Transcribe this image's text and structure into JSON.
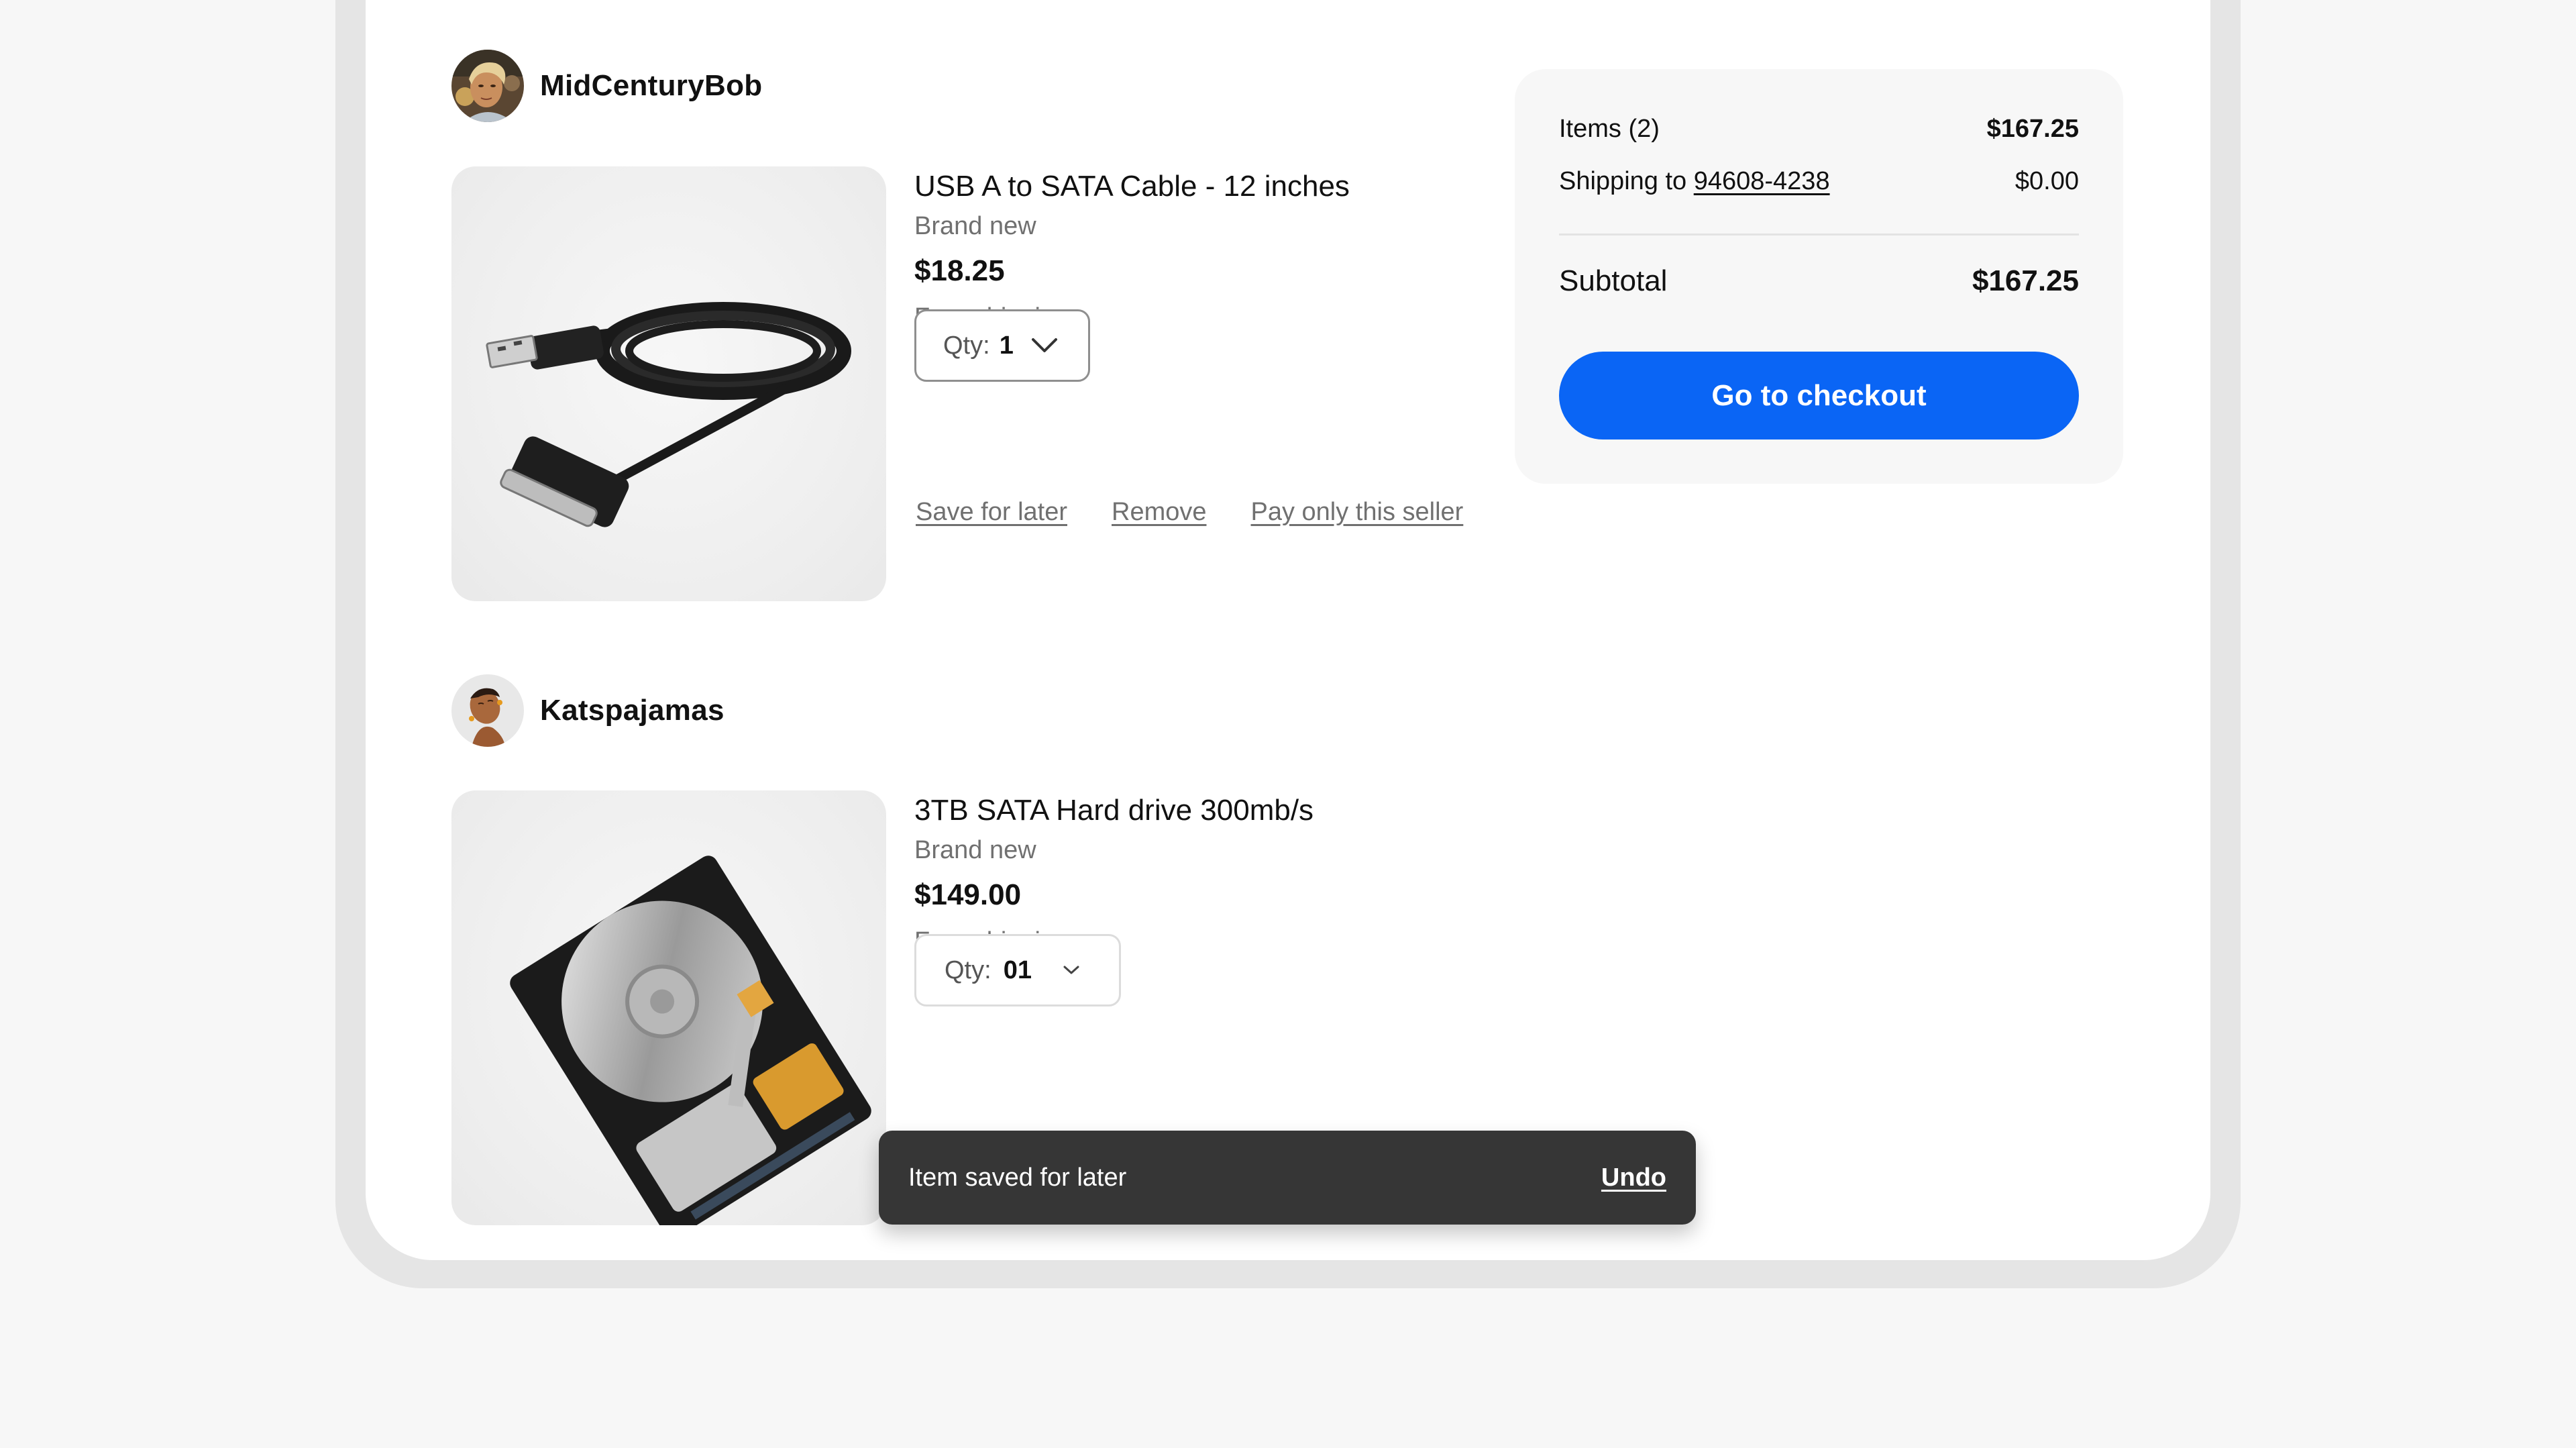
{
  "sellers": [
    {
      "name": "MidCenturyBob",
      "avatar_icon": "user-avatar-photo",
      "item": {
        "title": "USB A to SATA Cable - 12 inches",
        "condition": "Brand new",
        "price": "$18.25",
        "shipping": "Free shipping",
        "qty_label": "Qty:",
        "qty_value": "1",
        "image_icon": "usb-cable-photo"
      },
      "actions": [
        "Save for later",
        "Remove",
        "Pay only this seller"
      ]
    },
    {
      "name": "Katspajamas",
      "avatar_icon": "user-avatar-photo",
      "item": {
        "title": "3TB SATA Hard drive 300mb/s",
        "condition": "Brand new",
        "price": "$149.00",
        "shipping": "Free shipping",
        "qty_label": "Qty:",
        "qty_value": "01",
        "image_icon": "hard-drive-photo"
      }
    }
  ],
  "summary": {
    "items_label": "Items (2)",
    "items_value": "$167.25",
    "shipping_prefix": "Shipping to",
    "shipping_zip": "94608-4238",
    "shipping_value": "$0.00",
    "subtotal_label": "Subtotal",
    "subtotal_value": "$167.25",
    "checkout_label": "Go to checkout"
  },
  "toast": {
    "message": "Item saved for later",
    "action": "Undo"
  },
  "colors": {
    "accent": "#0a65f5",
    "toast_bg": "#363636",
    "summary_bg": "#f7f7f7",
    "muted_text": "#707070"
  }
}
